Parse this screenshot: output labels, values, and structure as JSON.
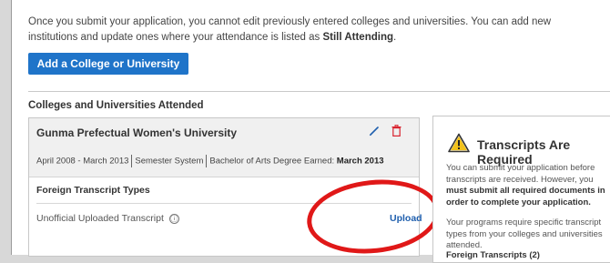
{
  "intro": {
    "text_before": "Once you submit your application, you cannot edit previously entered colleges and universities. You can add new institutions and update ones where your attendance is listed as ",
    "emphasis": "Still Attending",
    "text_after": "."
  },
  "add_button_label": "Add a College or University",
  "section_title": "Colleges and Universities Attended",
  "college": {
    "name": "Gunma Prefectual Women's University",
    "dates": "April 2008 - March 2013",
    "system": "Semester System",
    "degree_prefix": "Bachelor of Arts Degree Earned: ",
    "degree_date": "March 2013",
    "foreign_title": "Foreign Transcript Types",
    "transcript_label": "Unofficial Uploaded Transcript",
    "info_icon": "ⓘ",
    "upload_label": "Upload"
  },
  "sidebar": {
    "title": "Transcripts Are Required",
    "p1_before": "You can submit your application before transcripts are received. However, you ",
    "p1_bold": "must submit all required documents in order to complete your application.",
    "p2": "Your programs require specific transcript types from your colleges and universities attended.",
    "p3": "Foreign Transcripts (2)"
  },
  "colors": {
    "accent": "#1f74c9",
    "link": "#1f5fae",
    "delete": "#d9232f",
    "annotation": "#e01818"
  }
}
